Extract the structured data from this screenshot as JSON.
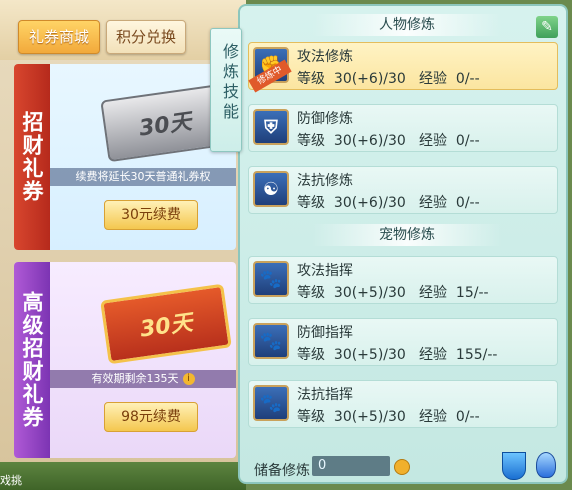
{
  "shop": {
    "tabs": {
      "mall": "礼券商城",
      "exchange": "积分兑换"
    },
    "card1": {
      "ribbon": "招财礼券",
      "coupon_text": "30天",
      "note": "续费将延长30天普通礼券权",
      "button": "30元续费"
    },
    "card2": {
      "ribbon": "高级招财礼券",
      "coupon_text": "30天",
      "note": "有效期剩余135天",
      "button": "98元续费"
    }
  },
  "corner_text": "戏挑",
  "title_tab": "修炼技能",
  "panel": {
    "char_section": "人物修炼",
    "pet_section": "宠物修炼",
    "char_skills": [
      {
        "name": "攻法修炼",
        "level_label": "等级",
        "level": "30(+6)/30",
        "exp_label": "经验",
        "exp": "0/--",
        "badge": "修炼中"
      },
      {
        "name": "防御修炼",
        "level_label": "等级",
        "level": "30(+6)/30",
        "exp_label": "经验",
        "exp": "0/--"
      },
      {
        "name": "法抗修炼",
        "level_label": "等级",
        "level": "30(+6)/30",
        "exp_label": "经验",
        "exp": "0/--"
      }
    ],
    "pet_skills": [
      {
        "name": "攻法指挥",
        "level_label": "等级",
        "level": "30(+5)/30",
        "exp_label": "经验",
        "exp": "15/--"
      },
      {
        "name": "防御指挥",
        "level_label": "等级",
        "level": "30(+5)/30",
        "exp_label": "经验",
        "exp": "155/--"
      },
      {
        "name": "法抗指挥",
        "level_label": "等级",
        "level": "30(+5)/30",
        "exp_label": "经验",
        "exp": "0/--"
      }
    ],
    "reserve_label": "储备修炼",
    "reserve_value": "0"
  }
}
